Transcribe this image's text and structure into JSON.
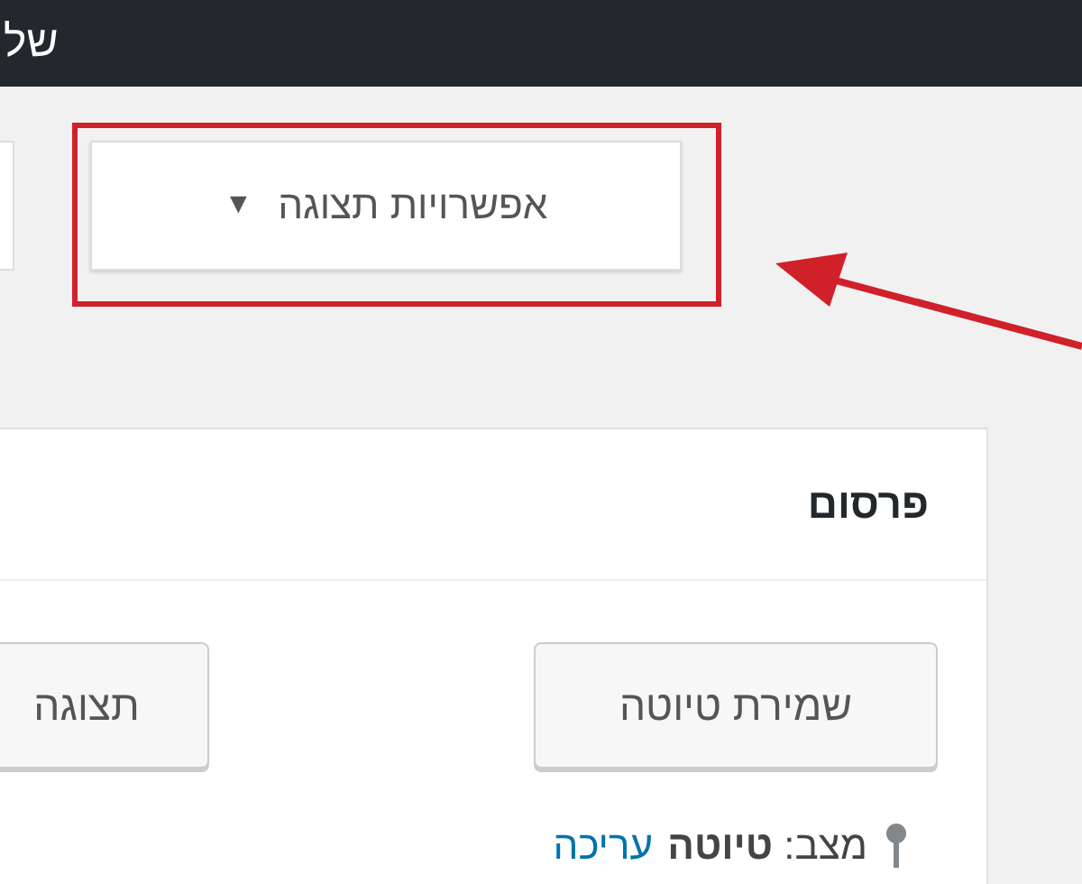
{
  "top_bar": {
    "text": "של"
  },
  "screen_options": {
    "label": "אפשרויות תצוגה",
    "caret": "▼"
  },
  "publish_box": {
    "title": "פרסום",
    "save_draft": "שמירת טיוטה",
    "preview": "תצוגה",
    "status": "מצב: **טיוטה**",
    "edit_link": "עריכה"
  }
}
